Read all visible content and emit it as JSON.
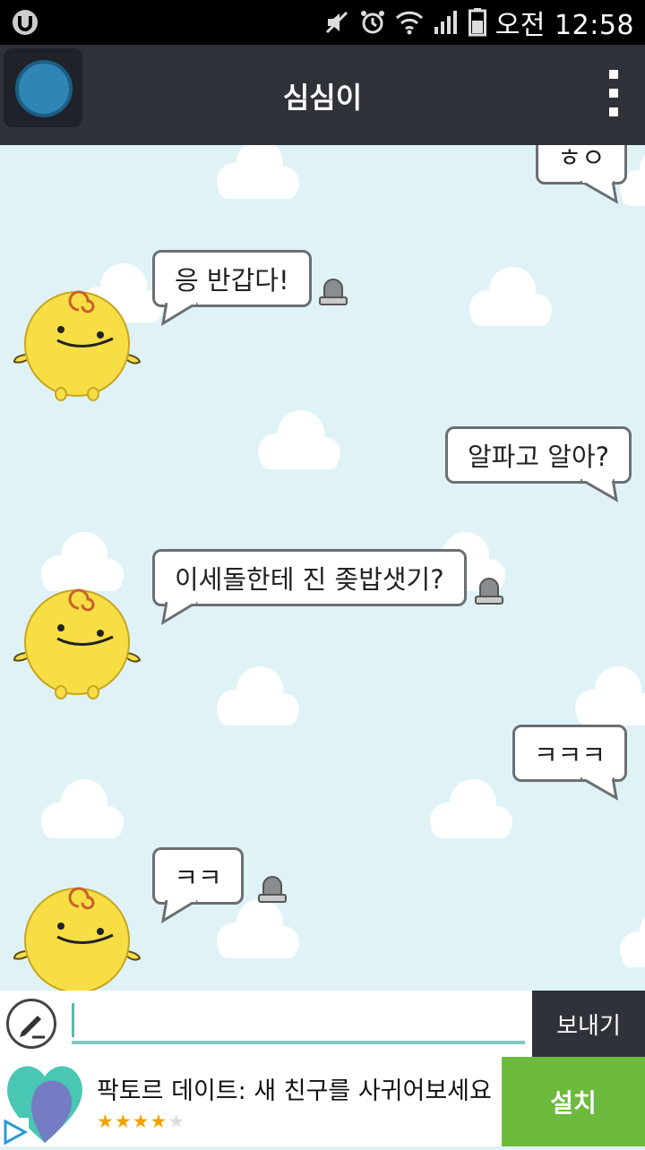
{
  "status_bar": {
    "time": "오전 12:58",
    "icons": [
      "carrier-u-icon",
      "mute-icon",
      "alarm-icon",
      "wifi-icon",
      "signal-icon",
      "battery-icon"
    ]
  },
  "app_bar": {
    "title": "심심이",
    "menu_icon": "overflow-menu-icon"
  },
  "messages": [
    {
      "sender": "user",
      "text": "ㅎㅇ"
    },
    {
      "sender": "bot",
      "text": "응 반갑다!"
    },
    {
      "sender": "user",
      "text": "알파고 알아?"
    },
    {
      "sender": "bot",
      "text": "이세돌한테 진 좆밥샛기?"
    },
    {
      "sender": "user",
      "text": "ㅋㅋㅋ"
    },
    {
      "sender": "bot",
      "text": "ㅋㅋ"
    }
  ],
  "input": {
    "value": "",
    "placeholder": "",
    "send_label": "보내기"
  },
  "ad": {
    "title": "팍토르 데이트: 새 친구를 사귀어보세요",
    "rating": 4,
    "rating_max": 5,
    "stars_on": "★★★★",
    "stars_off": "★",
    "install_label": "설치"
  },
  "colors": {
    "background": "#dff3f6",
    "app_bar": "#2f3239",
    "avatar_yellow": "#f7de45",
    "install_green": "#6cba3e",
    "input_underline": "#7fc9c4"
  }
}
